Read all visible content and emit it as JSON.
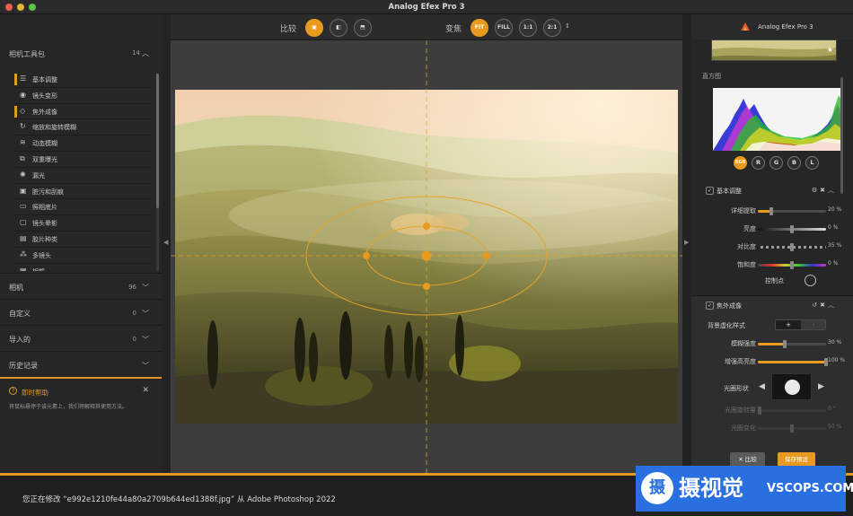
{
  "window": {
    "title": "Analog Efex Pro 3"
  },
  "left_panel": {
    "toolkit_title": "相机工具包",
    "toolkit_count": "14",
    "tools": [
      {
        "label": "基本调整",
        "icon": "sliders-icon",
        "active": true
      },
      {
        "label": "镜头变形",
        "icon": "lens-icon",
        "active": false
      },
      {
        "label": "焦外成像",
        "icon": "bokeh-icon",
        "active": true
      },
      {
        "label": "缩放和旋转模糊",
        "icon": "rotate-icon",
        "active": false
      },
      {
        "label": "动态模糊",
        "icon": "motion-icon",
        "active": false
      },
      {
        "label": "双重曝光",
        "icon": "double-icon",
        "active": false
      },
      {
        "label": "漏光",
        "icon": "light-leak-icon",
        "active": false
      },
      {
        "label": "脏污和刮痕",
        "icon": "dirt-icon",
        "active": false
      },
      {
        "label": "照相底片",
        "icon": "film-icon",
        "active": false
      },
      {
        "label": "镜头晕影",
        "icon": "vignette-icon",
        "active": false
      },
      {
        "label": "胶片种类",
        "icon": "film-type-icon",
        "active": false
      },
      {
        "label": "多镜头",
        "icon": "multi-lens-icon",
        "active": false
      },
      {
        "label": "相框",
        "icon": "frame-icon",
        "active": false
      }
    ],
    "sections": [
      {
        "title": "相机",
        "count": "96"
      },
      {
        "title": "自定义",
        "count": "0"
      },
      {
        "title": "导入的",
        "count": "0"
      },
      {
        "title": "历史记录",
        "count": ""
      }
    ],
    "help": {
      "title": "即时帮助",
      "text": "将鼠标悬停于该元素上，我们将解释其使用方法。"
    }
  },
  "toolbar": {
    "compare_label": "比较",
    "zoom_label": "变焦",
    "zoom_options": [
      "FIT",
      "FILL",
      "1:1",
      "2:1"
    ],
    "zoom_active": "FIT"
  },
  "right_panel": {
    "brand": "Analog Efex Pro 3",
    "histogram_label": "直方图",
    "channels": [
      "RGB",
      "R",
      "G",
      "B",
      "L"
    ],
    "basic": {
      "title": "基本调整",
      "sliders": [
        {
          "label": "详细提取",
          "value": "20 %",
          "fraction": 0.2
        },
        {
          "label": "亮度",
          "value": "0 %",
          "fraction": 0.5
        },
        {
          "label": "对比度",
          "value": "35 %",
          "fraction": 0.5
        },
        {
          "label": "饱和度",
          "value": "0 %",
          "fraction": 0.5
        }
      ],
      "control_points": "控制点"
    },
    "bokeh": {
      "title": "焦外成像",
      "style_label": "背景虚化样式",
      "style_options": [
        "+",
        "-"
      ],
      "sliders": [
        {
          "label": "模糊强度",
          "value": "30 %",
          "fraction": 0.4
        },
        {
          "label": "增强高亮度",
          "value": "100 %",
          "fraction": 1.0
        }
      ],
      "shape_label": "光圈形状",
      "dim_sliders": [
        {
          "label": "光圈旋转量",
          "value": "0 °",
          "fraction": 0.0
        },
        {
          "label": "光圈变化",
          "value": "50 %",
          "fraction": 0.5
        }
      ]
    },
    "buttons": {
      "compare": "比较",
      "save": "保存预设"
    }
  },
  "status": {
    "message": "您正在修改 “e992e1210fe44a80a2709b644ed1388f.jpg” 从 Adobe Photoshop 2022"
  },
  "watermark": {
    "cn": "摄视觉",
    "en": "VSCOPS.COM",
    "logo": "摄"
  },
  "colors": {
    "accent": "#e89a1e",
    "watermark_bg": "#2a6fe0"
  }
}
